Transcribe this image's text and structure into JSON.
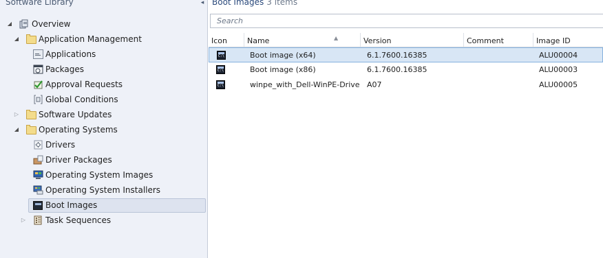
{
  "nav": {
    "title": "Software Library",
    "collapse_glyph": "◂",
    "items": [
      {
        "label": "Overview",
        "icon": "overview-icon"
      },
      {
        "label": "Application Management",
        "icon": "folder-icon"
      },
      {
        "label": "Applications",
        "icon": "applications-icon"
      },
      {
        "label": "Packages",
        "icon": "packages-icon"
      },
      {
        "label": "Approval Requests",
        "icon": "approval-requests-icon"
      },
      {
        "label": "Global Conditions",
        "icon": "global-conditions-icon"
      },
      {
        "label": "Software Updates",
        "icon": "folder-icon"
      },
      {
        "label": "Operating Systems",
        "icon": "folder-icon"
      },
      {
        "label": "Drivers",
        "icon": "drivers-icon"
      },
      {
        "label": "Driver Packages",
        "icon": "driver-packages-icon"
      },
      {
        "label": "Operating System Images",
        "icon": "os-images-icon"
      },
      {
        "label": "Operating System Installers",
        "icon": "os-installers-icon"
      },
      {
        "label": "Boot Images",
        "icon": "boot-images-icon"
      },
      {
        "label": "Task Sequences",
        "icon": "task-sequences-icon"
      }
    ]
  },
  "content": {
    "title": "Boot Images",
    "count": "3 items",
    "search_placeholder": "Search",
    "columns": [
      "Icon",
      "Name",
      "Version",
      "Comment",
      "Image ID"
    ],
    "rows": [
      {
        "name": "Boot image (x64)",
        "version": "6.1.7600.16385",
        "comment": "",
        "image_id": "ALU00004"
      },
      {
        "name": "Boot image (x86)",
        "version": "6.1.7600.16385",
        "comment": "",
        "image_id": "ALU00003"
      },
      {
        "name": "winpe_with_Dell-WinPE-Driver...",
        "version": "A07",
        "comment": "",
        "image_id": "ALU00005"
      }
    ]
  },
  "colors": {
    "nav_background": "#eef1f8",
    "selection": "#d8e6f5",
    "header_title": "#2b4a7c"
  }
}
